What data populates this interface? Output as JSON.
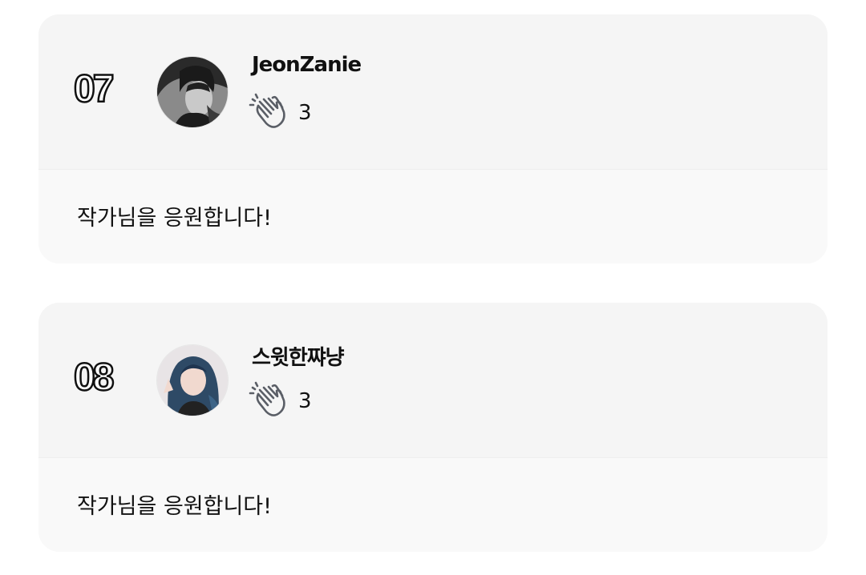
{
  "comments": [
    {
      "rank": "07",
      "username": "JeonZanie",
      "cheer_icon": "clapping-hands-icon",
      "cheer_count": "3",
      "message": "작가님을 응원합니다!"
    },
    {
      "rank": "08",
      "username": "스윗한쨔냥",
      "cheer_icon": "clapping-hands-icon",
      "cheer_count": "3",
      "message": "작가님을 응원합니다!"
    }
  ],
  "colors": {
    "card_header_bg": "#f5f5f5",
    "card_body_bg": "#f9f9f9",
    "text": "#111111",
    "icon_stroke": "#5a5e66"
  }
}
